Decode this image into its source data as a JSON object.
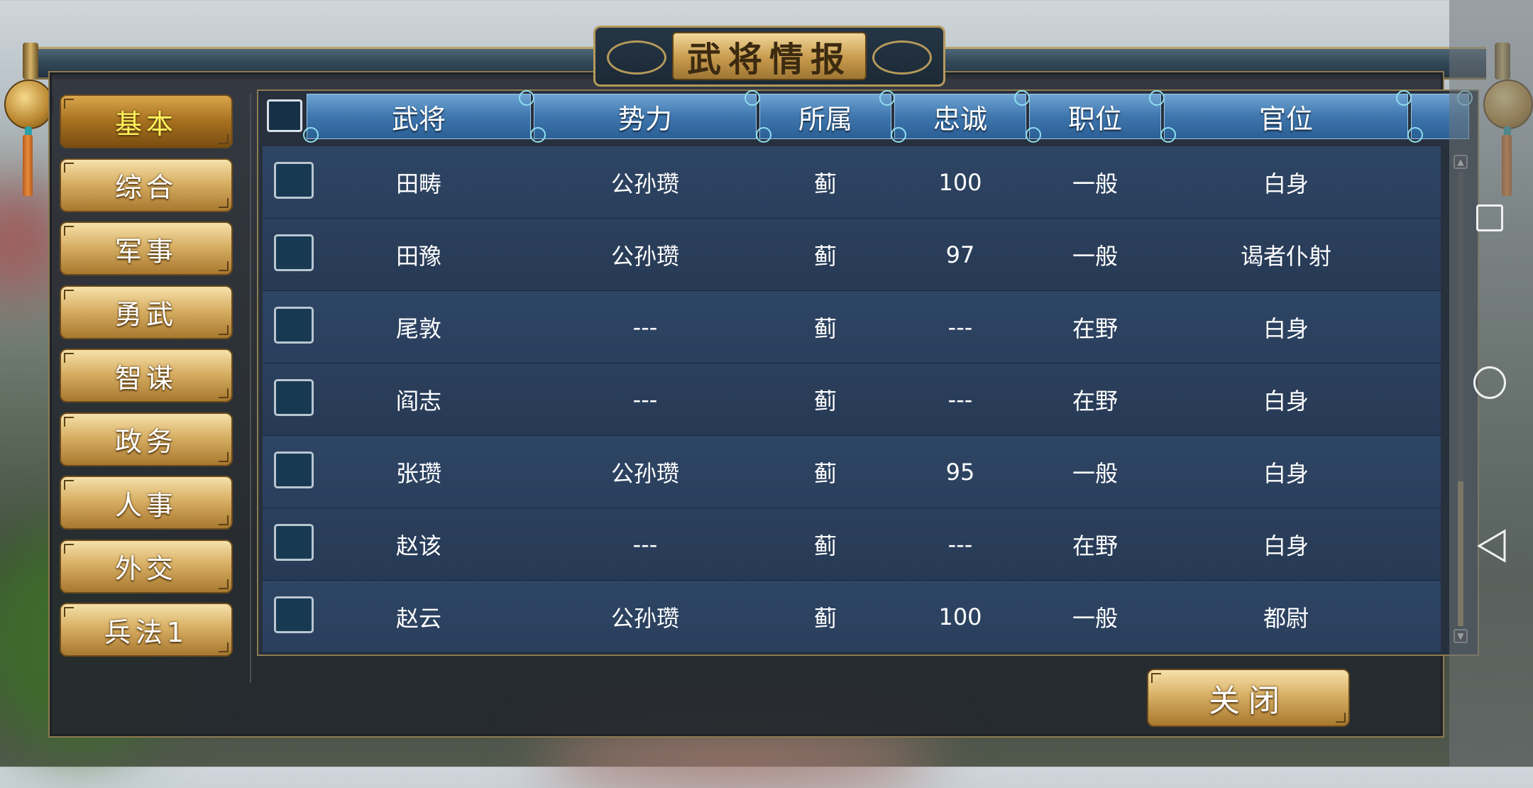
{
  "window": {
    "title": "武将情报"
  },
  "nav": {
    "items": [
      {
        "label": "基本",
        "active": true
      },
      {
        "label": "综合"
      },
      {
        "label": "军事"
      },
      {
        "label": "勇武"
      },
      {
        "label": "智谋"
      },
      {
        "label": "政务"
      },
      {
        "label": "人事"
      },
      {
        "label": "外交"
      },
      {
        "label": "兵法1"
      }
    ]
  },
  "table": {
    "headers": [
      "武将",
      "势力",
      "所属",
      "忠诚",
      "职位",
      "官位"
    ],
    "rows": [
      [
        "田畴",
        "公孙瓒",
        "蓟",
        "100",
        "一般",
        "白身"
      ],
      [
        "田豫",
        "公孙瓒",
        "蓟",
        "97",
        "一般",
        "谒者仆射"
      ],
      [
        "尾敦",
        "---",
        "蓟",
        "---",
        "在野",
        "白身"
      ],
      [
        "阎志",
        "---",
        "蓟",
        "---",
        "在野",
        "白身"
      ],
      [
        "张瓒",
        "公孙瓒",
        "蓟",
        "95",
        "一般",
        "白身"
      ],
      [
        "赵该",
        "---",
        "蓟",
        "---",
        "在野",
        "白身"
      ],
      [
        "赵云",
        "公孙瓒",
        "蓟",
        "100",
        "一般",
        "都尉"
      ]
    ]
  },
  "footer": {
    "close_label": "关闭"
  },
  "icons": {
    "scroll_up": "chevron-up-icon",
    "scroll_down": "chevron-down-icon",
    "recents": "square-icon",
    "home": "circle-icon",
    "back": "triangle-back-icon"
  },
  "colors": {
    "accent_gold": "#d8b065",
    "header_blue": "#3e76ad",
    "active_text": "#fff25a",
    "row_bg": "#2e4564"
  }
}
